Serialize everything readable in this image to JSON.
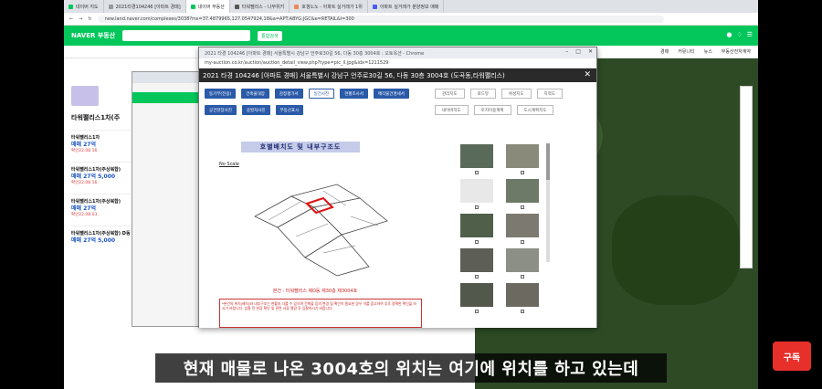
{
  "browser": {
    "tabs": [
      {
        "label": "네이버 지도"
      },
      {
        "label": "2021타경104246 [아파트 경매]"
      },
      {
        "label": "네이버 부동산"
      },
      {
        "label": "타워팰리스 - 나무위키"
      },
      {
        "label": "호갱노노 - 아파트 실거래가 1위"
      },
      {
        "label": "아파트 실거래가 분양정보 매매"
      }
    ],
    "url": "new.land.naver.com/complexes/3038?ms=37.4879965,127.0547924,18&a=APT:ABYG:JGC&e=RETAIL&l=300"
  },
  "naver": {
    "logo": "NAVER 부동산",
    "search_button": "통합검색",
    "right_nav": [
      "경매",
      "커뮤니티",
      "뉴스",
      "부동산전자계약"
    ]
  },
  "listing": {
    "title": "타워팰리스1차(주",
    "items": [
      {
        "name": "타워팰리스1차",
        "price": "매매 27억",
        "date": "확인22.08.16."
      },
      {
        "name": "타워팰리스1차(주상복합)",
        "price": "매매 27억 5,000",
        "date": "확인22.08.16."
      },
      {
        "name": "타워팰리스1차(주상복합)",
        "price": "매매 27억",
        "date": "확인22.08.03."
      },
      {
        "name": "타워팰리스1차(주상복합) D동",
        "price": "매매 27억 5,000",
        "date": ""
      }
    ]
  },
  "popup": {
    "window_title": "2021 타경 104246 [아파트 경매] 서울특별시 강남구 언주로30길 56, 다동 30층 3004호 : 오토옥션 - Chrome",
    "address_bar": "my-auction.co.kr/auction/auction_detail_view.php?type=pic_ll.jpg&idx=1211529",
    "header": "2021 타경 104246 [아파트 경매] 서울특별시 강남구 언주로30길 56, 다동 30층 3004호 (도곡동,타워팰리스)",
    "buttons_row1": [
      "등기부(전용)",
      "건축물대장",
      "감정평가서",
      "일건사진",
      "현황조사서",
      "매각물건명세서"
    ],
    "buttons_row2": [
      "공건현장사진",
      "승발처사진",
      "부동산표시"
    ],
    "selected_button": "일건사진",
    "right_buttons_row1": [
      "관리지도",
      "로드뷰",
      "위성지도",
      "지적도"
    ],
    "right_buttons_row2": [
      "네이버지도",
      "토지이용계획",
      "도시계획지도"
    ],
    "plan_title": "호별배치도 및 내부구조도",
    "no_scale": "No Scale",
    "caption": "본건 : 타워팰리스 제D동 제30층 제3004호",
    "note": "*본건의 위치(배치)와 내부구조는 현황과 다를 수 있으며 건축물 등의 변경 및 확인이 필요한 경우 이를 참고하여 추후 정확한 확인을 하시기 바랍니다. 입찰 전 현장 확인 및 관련 서류 열람 후 입찰하시기 바랍니다."
  },
  "subtitle": "현재 매물로 나온 3004호의 위치는 여기에 위치를 하고 있는데",
  "channel_logo": "구독"
}
